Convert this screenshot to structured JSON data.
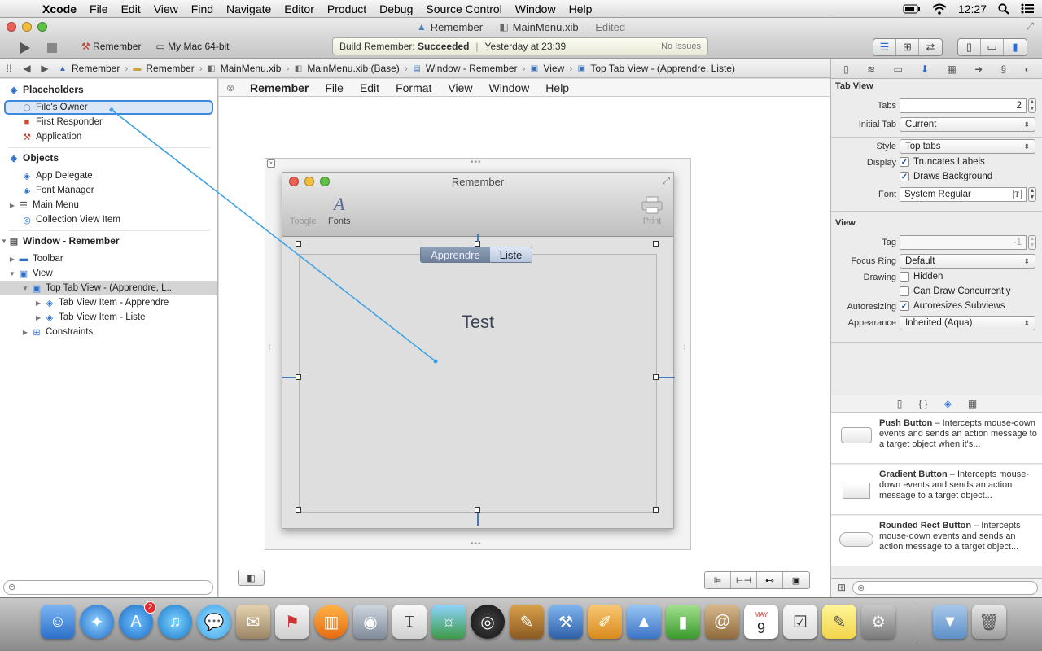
{
  "menubar": {
    "app": "Xcode",
    "items": [
      "File",
      "Edit",
      "View",
      "Find",
      "Navigate",
      "Editor",
      "Product",
      "Debug",
      "Source Control",
      "Window",
      "Help"
    ],
    "clock": "12:27"
  },
  "window": {
    "title_project": "Remember",
    "title_sep": "—",
    "title_file": "MainMenu.xib",
    "title_edited": "— Edited"
  },
  "toolbar": {
    "scheme": "Remember",
    "destination": "My Mac 64-bit",
    "activity_prefix": "Build Remember:",
    "activity_status": "Succeeded",
    "activity_time": "Yesterday at 23:39",
    "activity_issues": "No Issues"
  },
  "jumpbar": {
    "crumbs": [
      "Remember",
      "Remember",
      "MainMenu.xib",
      "MainMenu.xib (Base)",
      "Window - Remember",
      "View",
      "Top Tab View - (Apprendre, Liste)"
    ]
  },
  "navigator": {
    "placeholders_header": "Placeholders",
    "files_owner": "File's Owner",
    "first_responder": "First Responder",
    "application": "Application",
    "objects_header": "Objects",
    "app_delegate": "App Delegate",
    "font_manager": "Font Manager",
    "main_menu": "Main Menu",
    "collection_view_item": "Collection View Item",
    "window_header": "Window - Remember",
    "toolbar": "Toolbar",
    "view": "View",
    "top_tab_view": "Top Tab View - (Apprendre, L...",
    "tab_item_apprendre": "Tab View Item - Apprendre",
    "tab_item_liste": "Tab View Item - Liste",
    "constraints": "Constraints"
  },
  "canvas": {
    "menu": {
      "app": "Remember",
      "items": [
        "File",
        "Edit",
        "Format",
        "View",
        "Window",
        "Help"
      ]
    },
    "rwindow_title": "Remember",
    "tool_toggle": "Toogle",
    "tool_fonts": "Fonts",
    "tool_print": "Print",
    "tab_apprendre": "Apprendre",
    "tab_liste": "Liste",
    "test_label": "Test"
  },
  "inspector": {
    "tabview_header": "Tab View",
    "tabs_label": "Tabs",
    "tabs_value": "2",
    "initial_tab_label": "Initial Tab",
    "initial_tab_value": "Current",
    "style_label": "Style",
    "style_value": "Top tabs",
    "display_label": "Display",
    "truncates_labels": "Truncates Labels",
    "draws_background": "Draws Background",
    "font_label": "Font",
    "font_value": "System Regular",
    "view_header": "View",
    "tag_label": "Tag",
    "tag_value": "-1",
    "focus_ring_label": "Focus Ring",
    "focus_ring_value": "Default",
    "drawing_label": "Drawing",
    "hidden": "Hidden",
    "can_draw_concurrently": "Can Draw Concurrently",
    "autoresizing_label": "Autoresizing",
    "autoresizes_subviews": "Autoresizes Subviews",
    "appearance_label": "Appearance",
    "appearance_value": "Inherited (Aqua)"
  },
  "library": {
    "items": [
      {
        "name": "Push Button",
        "desc": " – Intercepts mouse-down events and sends an action message to a target object when it's..."
      },
      {
        "name": "Gradient Button",
        "desc": " – Intercepts mouse-down events and sends an action message to a target object..."
      },
      {
        "name": "Rounded Rect Button",
        "desc": " – Intercepts mouse-down events and sends an action message to a target object..."
      }
    ]
  },
  "dock": {
    "appstore_badge": "2",
    "calendar_month": "MAY",
    "calendar_day": "9"
  },
  "colors": {
    "accent": "#3d88e0",
    "connection_line": "#3aa0e8"
  }
}
